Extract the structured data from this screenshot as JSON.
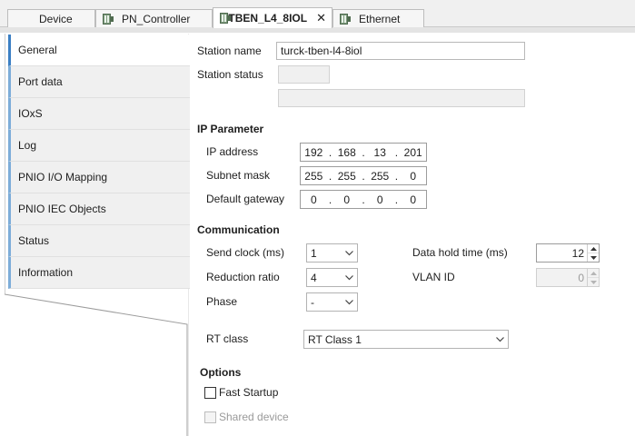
{
  "tabs": [
    {
      "label": "Device",
      "icon": "device-icon",
      "active": false
    },
    {
      "label": "PN_Controller",
      "icon": "plc-module-icon",
      "active": false
    },
    {
      "label": "TBEN_L4_8IOL",
      "icon": "plc-module-icon",
      "active": true
    },
    {
      "label": "Ethernet",
      "icon": "plc-module-icon",
      "active": false
    }
  ],
  "tab_close_glyph": "✕",
  "nav": {
    "items": [
      "General",
      "Port data",
      "IOxS",
      "Log",
      "PNIO I/O Mapping",
      "PNIO IEC Objects",
      "Status",
      "Information"
    ],
    "active_index": 0
  },
  "general": {
    "station_name_label": "Station name",
    "station_name_value": "turck-tben-l4-8iol",
    "station_status_label": "Station status"
  },
  "ip": {
    "section": "IP Parameter",
    "address_label": "IP address",
    "address": [
      "192",
      "168",
      "13",
      "201"
    ],
    "subnet_label": "Subnet mask",
    "subnet": [
      "255",
      "255",
      "255",
      "0"
    ],
    "gateway_label": "Default gateway",
    "gateway": [
      "0",
      "0",
      "0",
      "0"
    ]
  },
  "comm": {
    "section": "Communication",
    "send_clock_label": "Send clock (ms)",
    "send_clock_value": "1",
    "reduction_label": "Reduction ratio",
    "reduction_value": "4",
    "phase_label": "Phase",
    "phase_value": "-",
    "data_hold_label": "Data hold time (ms)",
    "data_hold_value": "12",
    "vlan_label": "VLAN ID",
    "vlan_value": "0",
    "rt_class_label": "RT class",
    "rt_class_value": "RT Class 1"
  },
  "options": {
    "section": "Options",
    "fast_startup_label": "Fast Startup",
    "fast_startup_checked": false,
    "shared_device_label": "Shared device",
    "shared_device_checked": false,
    "shared_device_enabled": false
  },
  "colors": {
    "nav_accent": "#7dadd9",
    "nav_active_accent": "#3b7fc4",
    "module_icon": "#7e9b7e"
  }
}
